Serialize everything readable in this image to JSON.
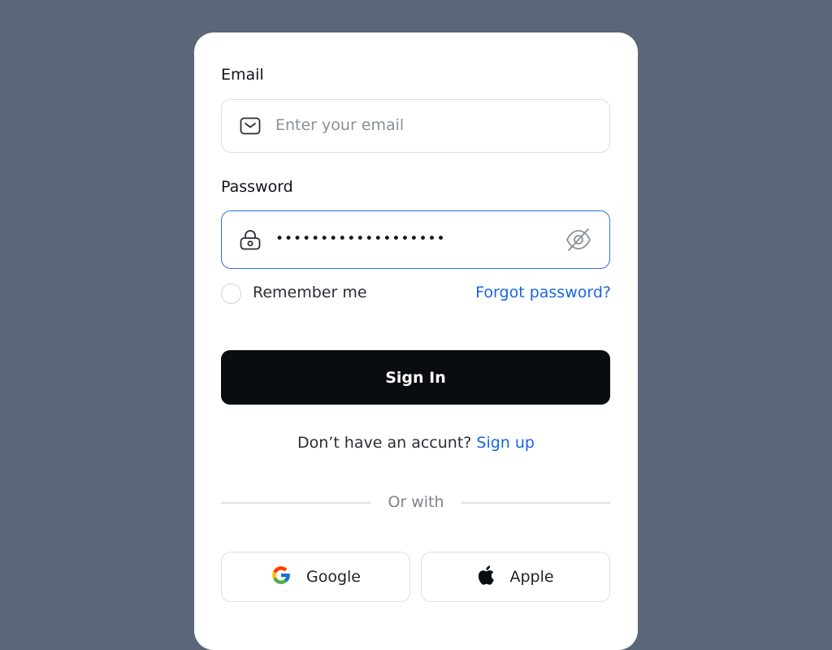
{
  "email": {
    "label": "Email",
    "placeholder": "Enter your email",
    "icon": "mail-icon"
  },
  "password": {
    "label": "Password",
    "value": "•••••••••••••••••••",
    "icon": "lock-icon",
    "toggle_icon": "eye-off-icon"
  },
  "remember": {
    "label": "Remember me",
    "checked": false
  },
  "forgot": {
    "label": "Forgot password?"
  },
  "signin": {
    "label": "Sign In"
  },
  "signup": {
    "prompt": "Don’t have an accunt?",
    "link": "Sign up"
  },
  "divider": {
    "label": "Or with"
  },
  "social": {
    "google": {
      "label": "Google",
      "icon": "google-icon"
    },
    "apple": {
      "label": "Apple",
      "icon": "apple-icon"
    }
  },
  "colors": {
    "background": "#5b6779",
    "card": "#ffffff",
    "primary_button": "#090c10",
    "link": "#1a66e0",
    "focus_border": "#2f6fe0"
  }
}
